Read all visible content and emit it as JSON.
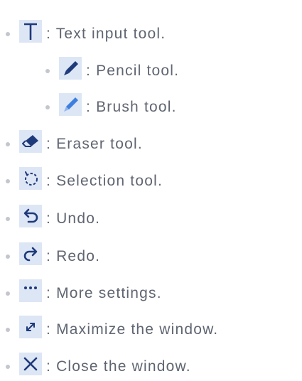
{
  "items": [
    {
      "icon": "text-input-icon",
      "text": ": Text input tool."
    },
    {
      "icon": "pencil-icon",
      "text": ": Pencil tool."
    },
    {
      "icon": "brush-icon",
      "text": ": Brush tool."
    },
    {
      "icon": "eraser-icon",
      "text": ": Eraser tool."
    },
    {
      "icon": "lasso-selection-icon",
      "text": ": Selection tool."
    },
    {
      "icon": "undo-icon",
      "text": ": Undo."
    },
    {
      "icon": "redo-icon",
      "text": ": Redo."
    },
    {
      "icon": "more-dots-icon",
      "text": ": More settings."
    },
    {
      "icon": "maximize-icon",
      "text": ": Maximize the window."
    },
    {
      "icon": "close-icon",
      "text": ": Close the window."
    }
  ],
  "colors": {
    "text": "#5f6571",
    "bullet": "#c3c7cd",
    "icon_bg": "#dde6f5",
    "icon_dark": "#1f3a7a",
    "icon_blue": "#3d7fe0"
  }
}
